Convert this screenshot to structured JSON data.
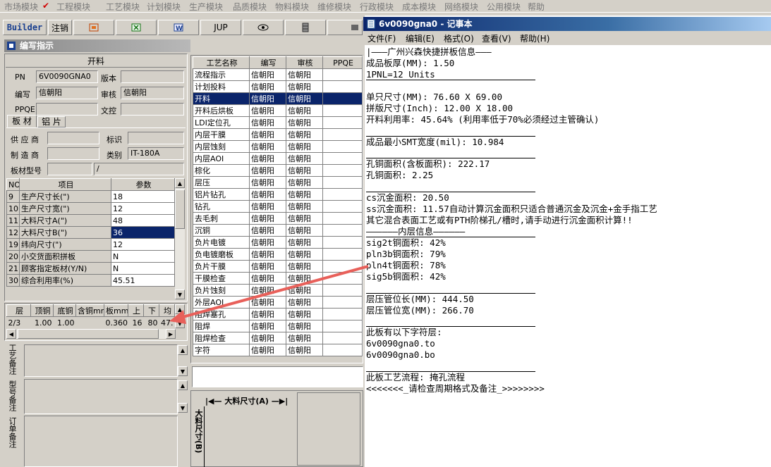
{
  "top_menu": [
    {
      "label": "市场模块"
    },
    {
      "label": "工程模块",
      "checked": true
    },
    {
      "label": "工艺模块"
    },
    {
      "label": "计划模块"
    },
    {
      "label": "生产模块"
    },
    {
      "label": "品质模块"
    },
    {
      "label": "物料模块"
    },
    {
      "label": "维修模块"
    },
    {
      "label": "行政模块"
    },
    {
      "label": "成本模块"
    },
    {
      "label": "网络模块"
    },
    {
      "label": "公用模块"
    },
    {
      "label": "帮助"
    }
  ],
  "toolbar": {
    "builder": "Builder",
    "logout": "注销",
    "jup": "JUP"
  },
  "editor": {
    "title": "编写指示",
    "section": "开料",
    "pn_label": "PN",
    "pn_value": "6V0090GNA0",
    "version_label": "版本",
    "version_value": "",
    "author_label": "编写",
    "author_value": "信朝阳",
    "review_label": "审核",
    "review_value": "信朝阳",
    "ppqe_label": "PPQE",
    "ppqe_value": "",
    "doc_label": "文控",
    "doc_value": "",
    "tab_board": "板 材",
    "tab_al": "铝 片",
    "supplier_label": "供 应 商",
    "mark_label": "标识",
    "maker_label": "制 造 商",
    "category_label": "类别",
    "category_value": "IT-180A",
    "model_label": "板材型号",
    "model_value": "/"
  },
  "param_table": {
    "headers": [
      "NO",
      "项目",
      "参数"
    ],
    "rows": [
      {
        "no": "9",
        "item": "生产尺寸长(\")",
        "val": "18"
      },
      {
        "no": "10",
        "item": "生产尺寸宽(\")",
        "val": "12"
      },
      {
        "no": "11",
        "item": "大料尺寸A(\")",
        "val": "48"
      },
      {
        "no": "12",
        "item": "大料尺寸B(\")",
        "val": "36",
        "selected": true
      },
      {
        "no": "19",
        "item": "纬向尺寸(\")",
        "val": "12"
      },
      {
        "no": "20",
        "item": "小交货面积拼板",
        "val": "N"
      },
      {
        "no": "21",
        "item": "顾客指定板材(Y/N)",
        "val": "N"
      },
      {
        "no": "30",
        "item": "综合利用率(%)",
        "val": "45.51"
      }
    ]
  },
  "layer_table": {
    "headers": [
      "层",
      "顶铜",
      "底铜",
      "含铜mm",
      "板mm",
      "上",
      "下",
      "均"
    ],
    "row": [
      "2/3",
      "1.00",
      "1.00",
      "",
      "0.360",
      "16",
      "80",
      "47."
    ]
  },
  "notes": {
    "process": "工艺备注",
    "model": "型号备注",
    "order": "订单备注"
  },
  "process_table": {
    "headers": [
      "工艺名称",
      "编写",
      "审核",
      "PPQE"
    ],
    "rows": [
      {
        "name": "流程指示",
        "a": "信朝阳",
        "b": "信朝阳"
      },
      {
        "name": "计划投料",
        "a": "信朝阳",
        "b": "信朝阳"
      },
      {
        "name": "开料",
        "a": "信朝阳",
        "b": "信朝阳",
        "selected": true
      },
      {
        "name": "开料后烘板",
        "a": "信朝阳",
        "b": "信朝阳"
      },
      {
        "name": "LDI定位孔",
        "a": "信朝阳",
        "b": "信朝阳"
      },
      {
        "name": "内层干膜",
        "a": "信朝阳",
        "b": "信朝阳"
      },
      {
        "name": "内层蚀刻",
        "a": "信朝阳",
        "b": "信朝阳"
      },
      {
        "name": "内层AOI",
        "a": "信朝阳",
        "b": "信朝阳"
      },
      {
        "name": "棕化",
        "a": "信朝阳",
        "b": "信朝阳"
      },
      {
        "name": "层压",
        "a": "信朝阳",
        "b": "信朝阳"
      },
      {
        "name": "铝片钻孔",
        "a": "信朝阳",
        "b": "信朝阳"
      },
      {
        "name": "钻孔",
        "a": "信朝阳",
        "b": "信朝阳"
      },
      {
        "name": "去毛刺",
        "a": "信朝阳",
        "b": "信朝阳"
      },
      {
        "name": "沉铜",
        "a": "信朝阳",
        "b": "信朝阳"
      },
      {
        "name": "负片电镀",
        "a": "信朝阳",
        "b": "信朝阳"
      },
      {
        "name": "负电镀磨板",
        "a": "信朝阳",
        "b": "信朝阳"
      },
      {
        "name": "负片干膜",
        "a": "信朝阳",
        "b": "信朝阳"
      },
      {
        "name": "干膜检查",
        "a": "信朝阳",
        "b": "信朝阳"
      },
      {
        "name": "负片蚀刻",
        "a": "信朝阳",
        "b": "信朝阳"
      },
      {
        "name": "外层AOI",
        "a": "信朝阳",
        "b": "信朝阳"
      },
      {
        "name": "阻焊塞孔",
        "a": "信朝阳",
        "b": "信朝阳"
      },
      {
        "name": "阻焊",
        "a": "信朝阳",
        "b": "信朝阳"
      },
      {
        "name": "阻焊检查",
        "a": "信朝阳",
        "b": "信朝阳"
      },
      {
        "name": "字符",
        "a": "信朝阳",
        "b": "信朝阳"
      }
    ]
  },
  "diagram": {
    "size_a": "大料尺寸(A)",
    "size_b": "大料尺寸(B)"
  },
  "notepad": {
    "title": "6v0090gna0 - 记事本",
    "menu": [
      "文件(F)",
      "编辑(E)",
      "格式(O)",
      "查看(V)",
      "帮助(H)"
    ],
    "lines": [
      "|———广州兴森快捷拼板信息———",
      "成品板厚(MM): 1.50",
      "1PNL=12 Units",
      "",
      "单只尺寸(MM): 76.60 X 69.00",
      "拼版尺寸(Inch): 12.00 X 18.00",
      "开料利用率: 45.64% (利用率低于70%必须经过主管确认)",
      "",
      "成品最小SMT宽度(mil): 10.984",
      "",
      "孔铜面积(含板面积): 222.17",
      "孔铜面积: 2.25",
      "",
      "cs沉金面积: 20.50",
      "ss沉金面积: 11.57自动计算沉金面积只适合普通沉金及沉金+金手指工艺",
      "其它混合表面工艺或有PTH阶梯孔/槽时,请手动进行沉金面积计算!!",
      "——————内层信息——————",
      "sig2t铜面积: 42%",
      "pln3b铜面积: 79%",
      "pln4t铜面积: 78%",
      "sig5b铜面积: 42%",
      "",
      "层压管位长(MM): 444.50",
      "层压管位宽(MM): 266.70",
      "",
      "此板有以下字符层:",
      "6v0090gna0.to",
      "6v0090gna0.bo",
      "",
      "此板工艺流程: 掩孔流程",
      "<<<<<<<_请检查周期格式及备注_>>>>>>>>"
    ]
  },
  "colors": {
    "selection": "#0a246a",
    "annotation_arrow": "#e8605a"
  }
}
